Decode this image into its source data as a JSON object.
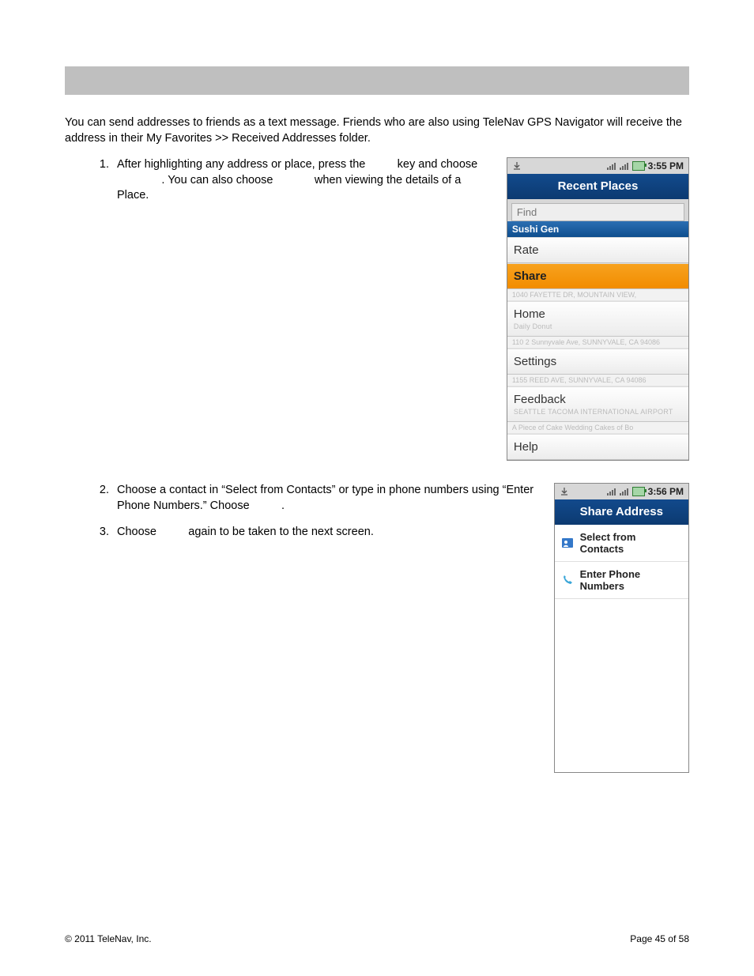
{
  "intro": "You can send addresses to friends as a text message. Friends who are also using TeleNav GPS Navigator will receive the address in their My Favorites >> Received Addresses folder.",
  "steps": {
    "s1_num": "1.",
    "s1_part1": "After highlighting any address or place, press the ",
    "s1_part2": " key and choose ",
    "s1_part3": ". You can also choose ",
    "s1_part4": " when viewing the details of a Place.",
    "s2_num": "2.",
    "s2_part1": "Choose a contact in “Select from Contacts” or type in phone numbers using “Enter Phone Numbers.” Choose ",
    "s2_part2": ".",
    "s3_num": "3.",
    "s3_part1": "Choose ",
    "s3_part2": " again to be taken to the next screen."
  },
  "shot1": {
    "time": "3:55 PM",
    "title": "Recent Places",
    "find_placeholder": "Find",
    "sub_header": "Sushi Gen",
    "items": {
      "rate": "Rate",
      "share": "Share",
      "home": "Home",
      "settings": "Settings",
      "feedback": "Feedback",
      "help": "Help"
    },
    "ghosts": {
      "under_share": "1040 FAYETTE DR, MOUNTAIN VIEW,",
      "under_home": "Daily Donut",
      "under_home2": "110 2 Sunnyvale Ave, SUNNYVALE, CA 94086",
      "under_settings": "1155 REED AVE, SUNNYVALE, CA 94086",
      "under_feedback": "SEATTLE TACOMA INTERNATIONAL AIRPORT",
      "under_feedback2": "A Piece of Cake Wedding Cakes of Bo"
    }
  },
  "shot2": {
    "time": "3:56 PM",
    "title": "Share Address",
    "opt_contacts": "Select from Contacts",
    "opt_numbers": "Enter Phone Numbers"
  },
  "footer": {
    "copyright": "© 2011 TeleNav, Inc.",
    "page": "Page 45 of 58"
  }
}
